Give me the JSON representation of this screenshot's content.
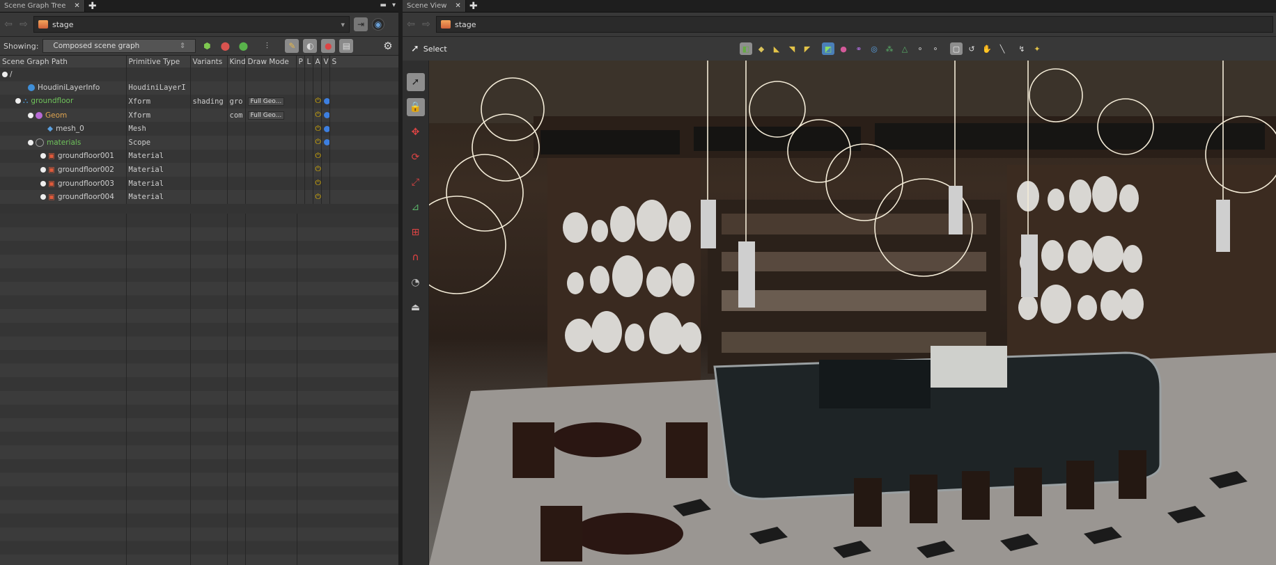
{
  "left_pane": {
    "tab_label": "Scene Graph Tree",
    "path": "stage",
    "showing_label": "Showing:",
    "showing_value": "Composed scene graph",
    "columns": [
      "Scene Graph Path",
      "Primitive Type",
      "Variants",
      "Kind",
      "Draw Mode",
      "P",
      "L",
      "A",
      "V",
      "S"
    ],
    "rows": [
      {
        "path": "/",
        "type": "",
        "variants": "",
        "kind": "",
        "drawmode": ""
      },
      {
        "path": "HoudiniLayerInfo",
        "type": "HoudiniLayerI",
        "variants": "",
        "kind": "",
        "drawmode": ""
      },
      {
        "path": "groundfloor",
        "type": "Xform",
        "variants": "shading",
        "kind": "gro",
        "drawmode": "Full Geo..."
      },
      {
        "path": "Geom",
        "type": "Xform",
        "variants": "",
        "kind": "com",
        "drawmode": "Full Geo..."
      },
      {
        "path": "mesh_0",
        "type": "Mesh",
        "variants": "",
        "kind": "",
        "drawmode": ""
      },
      {
        "path": "materials",
        "type": "Scope",
        "variants": "",
        "kind": "",
        "drawmode": ""
      },
      {
        "path": "groundfloor001",
        "type": "Material",
        "variants": "",
        "kind": "",
        "drawmode": ""
      },
      {
        "path": "groundfloor002",
        "type": "Material",
        "variants": "",
        "kind": "",
        "drawmode": ""
      },
      {
        "path": "groundfloor003",
        "type": "Material",
        "variants": "",
        "kind": "",
        "drawmode": ""
      },
      {
        "path": "groundfloor004",
        "type": "Material",
        "variants": "",
        "kind": "",
        "drawmode": ""
      }
    ]
  },
  "right_pane": {
    "tab_label": "Scene View",
    "path": "stage",
    "tool_mode": "Select"
  },
  "colors": {
    "green": "#6fc35b",
    "orange": "#e0a550",
    "power": "#e6b800",
    "eye": "#3d7fe0"
  }
}
